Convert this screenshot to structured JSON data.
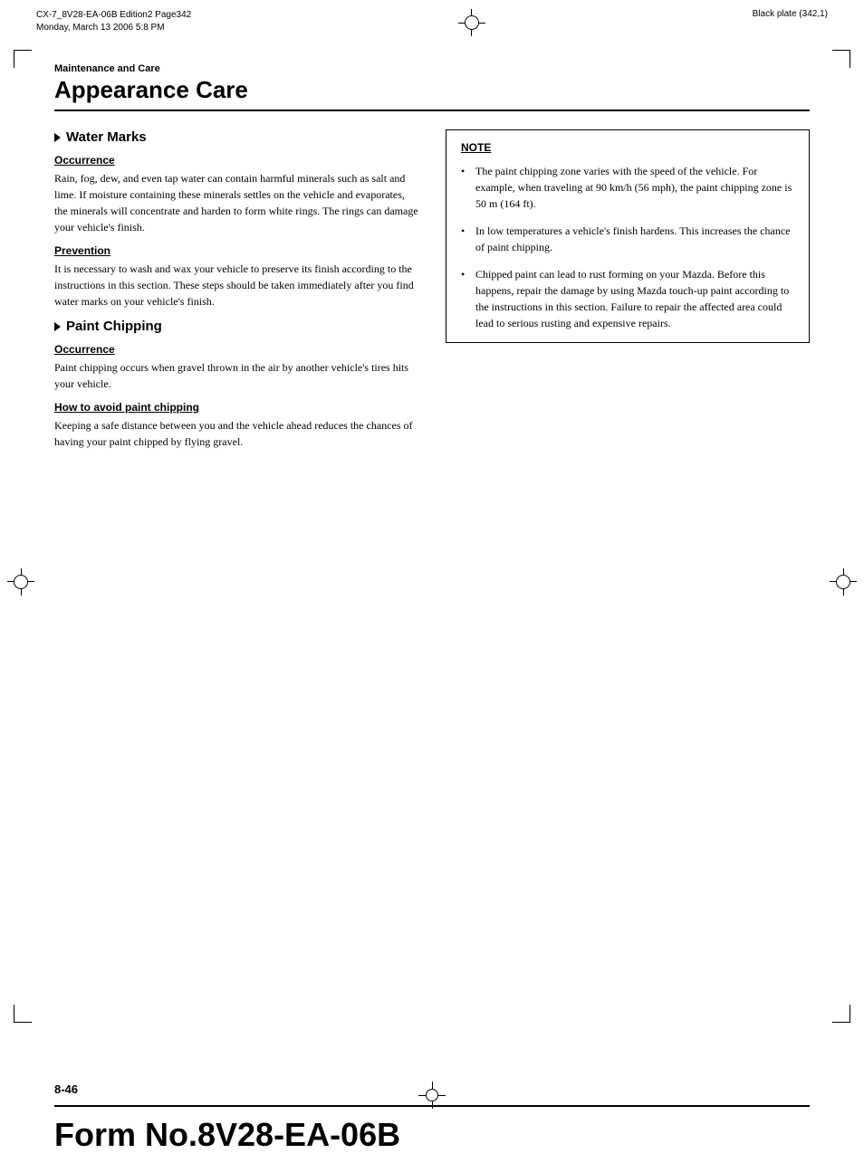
{
  "top_bar": {
    "left_line1": "CX-7_8V28-EA-06B  Edition2  Page342",
    "left_line2": "Monday, March 13  2006  5:8 PM",
    "right_text": "Black plate (342,1)"
  },
  "header": {
    "section_label": "Maintenance and Care",
    "title": "Appearance Care"
  },
  "left_col": {
    "section1": {
      "heading": "Water Marks",
      "subsection1": {
        "label": "Occurrence",
        "text": "Rain, fog, dew, and even tap water can contain harmful minerals such as salt and lime. If moisture containing these minerals settles on the vehicle and evaporates, the minerals will concentrate and harden to form white rings. The rings can damage your vehicle's finish."
      },
      "subsection2": {
        "label": "Prevention",
        "text": "It is necessary to wash and wax your vehicle to preserve its finish according to the instructions in this section. These steps should be taken immediately after you find water marks on your vehicle's finish."
      }
    },
    "section2": {
      "heading": "Paint Chipping",
      "subsection1": {
        "label": "Occurrence",
        "text": "Paint chipping occurs when gravel thrown in the air by another vehicle's tires hits your vehicle."
      },
      "subsection2": {
        "label": "How to avoid paint chipping",
        "text": "Keeping a safe distance between you and the vehicle ahead reduces the chances of having your paint chipped by flying gravel."
      }
    }
  },
  "right_col": {
    "note_box": {
      "title": "NOTE",
      "items": [
        "The paint chipping zone varies with the speed of the vehicle. For example, when traveling at 90 km/h (56 mph), the paint chipping zone is 50 m (164 ft).",
        "In low temperatures a vehicle's finish hardens. This increases the chance of paint chipping.",
        "Chipped paint can lead to rust forming on your Mazda. Before this happens, repair the damage by using Mazda touch-up paint according to the instructions in this section. Failure to repair the affected area could lead to serious rusting and expensive repairs."
      ]
    }
  },
  "bottom": {
    "page_number": "8-46",
    "form_number": "Form No.8V28-EA-06B"
  }
}
